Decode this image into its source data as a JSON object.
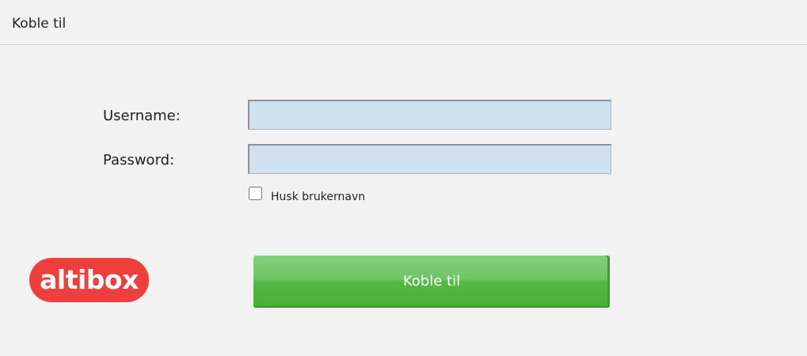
{
  "header": {
    "title": "Koble til"
  },
  "form": {
    "username_label": "Username:",
    "username_value": "",
    "password_label": "Password:",
    "password_value": "",
    "remember_label": "Husk brukernavn",
    "remember_checked": false
  },
  "logo": {
    "text": "altibox",
    "color": "#ee3f3d"
  },
  "actions": {
    "connect_label": "Koble til",
    "connect_color": "#56b845"
  }
}
